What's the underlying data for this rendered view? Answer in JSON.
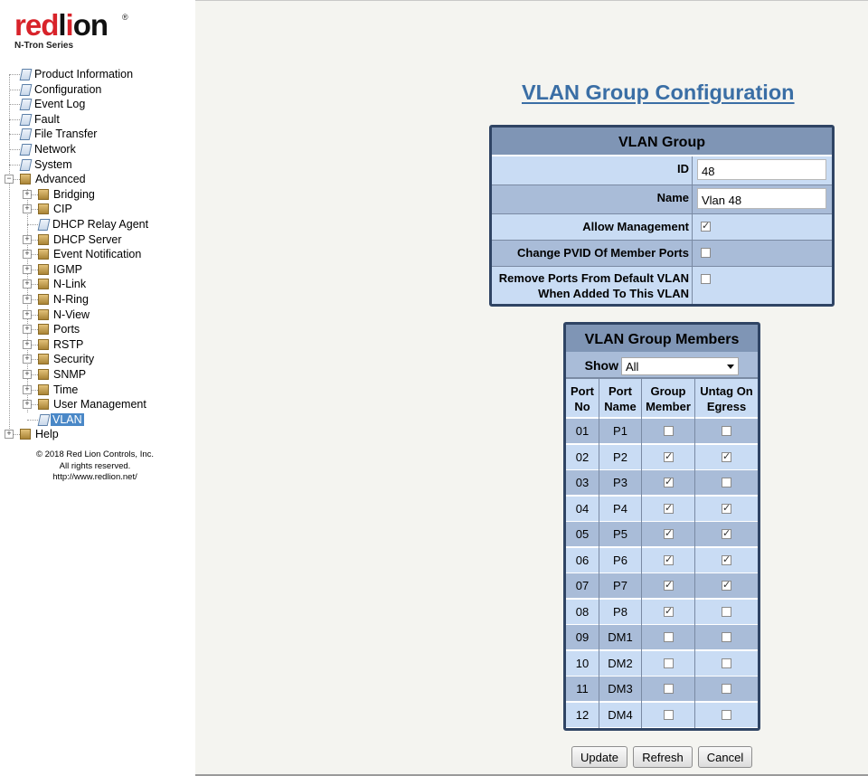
{
  "brand": {
    "name_red": "red",
    "name_black": "l",
    "name_red2": "i",
    "name_black2": "on",
    "reg": "®",
    "subtitle": "N-Tron Series"
  },
  "nav": {
    "items": [
      {
        "label": "Product Information"
      },
      {
        "label": "Configuration"
      },
      {
        "label": "Event Log"
      },
      {
        "label": "Fault"
      },
      {
        "label": "File Transfer"
      },
      {
        "label": "Network"
      },
      {
        "label": "System"
      },
      {
        "label": "Advanced"
      },
      {
        "label": "Bridging"
      },
      {
        "label": "CIP"
      },
      {
        "label": "DHCP Relay Agent"
      },
      {
        "label": "DHCP Server"
      },
      {
        "label": "Event Notification"
      },
      {
        "label": "IGMP"
      },
      {
        "label": "N-Link"
      },
      {
        "label": "N-Ring"
      },
      {
        "label": "N-View"
      },
      {
        "label": "Ports"
      },
      {
        "label": "RSTP"
      },
      {
        "label": "Security"
      },
      {
        "label": "SNMP"
      },
      {
        "label": "Time"
      },
      {
        "label": "User Management"
      },
      {
        "label": "VLAN"
      },
      {
        "label": "Help"
      }
    ],
    "selected": "VLAN"
  },
  "copyright": {
    "line1": "© 2018 Red Lion Controls, Inc.",
    "line2": "All rights reserved.",
    "line3": "http://www.redlion.net/"
  },
  "page_title": "VLAN Group Configuration",
  "vlan_group": {
    "header": "VLAN Group",
    "id_label": "ID",
    "id_value": "48",
    "name_label": "Name",
    "name_value": "Vlan 48",
    "allow_mgmt_label": "Allow Management",
    "allow_mgmt": true,
    "change_pvid_label": "Change PVID Of Member Ports",
    "change_pvid": false,
    "remove_ports_label_1": "Remove Ports From Default VLAN",
    "remove_ports_label_2": "When Added To This VLAN",
    "remove_ports": false
  },
  "members": {
    "header": "VLAN Group Members",
    "show_label": "Show",
    "show_value": "All",
    "col_port_no_1": "Port",
    "col_port_no_2": "No",
    "col_port_name_1": "Port",
    "col_port_name_2": "Name",
    "col_group_1": "Group",
    "col_group_2": "Member",
    "col_untag_1": "Untag On",
    "col_untag_2": "Egress",
    "rows": [
      {
        "no": "01",
        "name": "P1",
        "member": false,
        "untag": false
      },
      {
        "no": "02",
        "name": "P2",
        "member": true,
        "untag": true
      },
      {
        "no": "03",
        "name": "P3",
        "member": true,
        "untag": false
      },
      {
        "no": "04",
        "name": "P4",
        "member": true,
        "untag": true
      },
      {
        "no": "05",
        "name": "P5",
        "member": true,
        "untag": true
      },
      {
        "no": "06",
        "name": "P6",
        "member": true,
        "untag": true
      },
      {
        "no": "07",
        "name": "P7",
        "member": true,
        "untag": true
      },
      {
        "no": "08",
        "name": "P8",
        "member": true,
        "untag": false
      },
      {
        "no": "09",
        "name": "DM1",
        "member": false,
        "untag": false
      },
      {
        "no": "10",
        "name": "DM2",
        "member": false,
        "untag": false
      },
      {
        "no": "11",
        "name": "DM3",
        "member": false,
        "untag": false
      },
      {
        "no": "12",
        "name": "DM4",
        "member": false,
        "untag": false
      }
    ]
  },
  "buttons": {
    "update": "Update",
    "refresh": "Refresh",
    "cancel": "Cancel"
  },
  "colors": {
    "accent": "#3a6ea5",
    "panel_border": "#2f4464",
    "panel_header": "#7f95b5",
    "row_light": "#c9dcf4",
    "row_dark": "#a9bcd8",
    "logo_red": "#d8232a"
  }
}
